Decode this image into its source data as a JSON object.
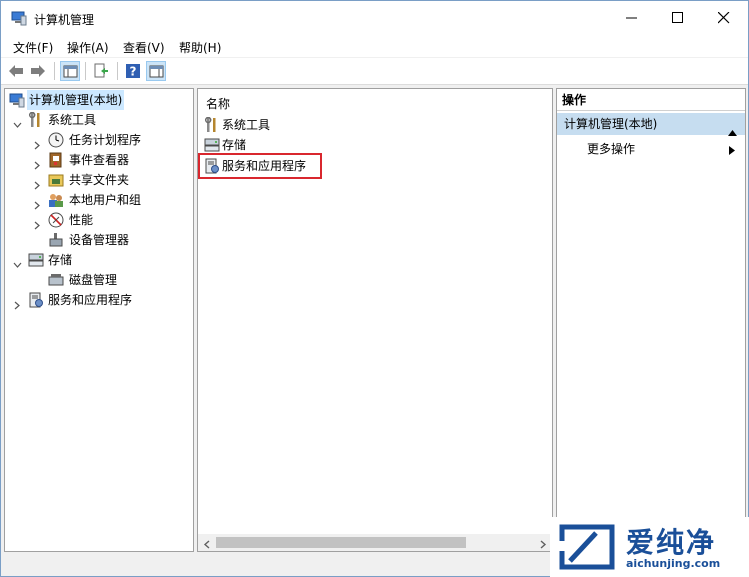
{
  "window": {
    "title": "计算机管理"
  },
  "menu": [
    "文件(F)",
    "操作(A)",
    "查看(V)",
    "帮助(H)"
  ],
  "tree": {
    "root": "计算机管理(本地)",
    "system_tools": {
      "label": "系统工具",
      "children": [
        "任务计划程序",
        "事件查看器",
        "共享文件夹",
        "本地用户和组",
        "性能",
        "设备管理器"
      ]
    },
    "storage": {
      "label": "存储",
      "children": [
        "磁盘管理"
      ]
    },
    "services": {
      "label": "服务和应用程序"
    }
  },
  "list": {
    "column": "名称",
    "items": [
      "系统工具",
      "存储",
      "服务和应用程序"
    ]
  },
  "actions": {
    "title": "操作",
    "group": "计算机管理(本地)",
    "more": "更多操作"
  },
  "watermark": {
    "brand": "爱纯净",
    "url": "aichunjing.com"
  },
  "colors": {
    "selection": "#cce8ff",
    "highlight_border": "#d9272e",
    "brand": "#1a4f99"
  }
}
